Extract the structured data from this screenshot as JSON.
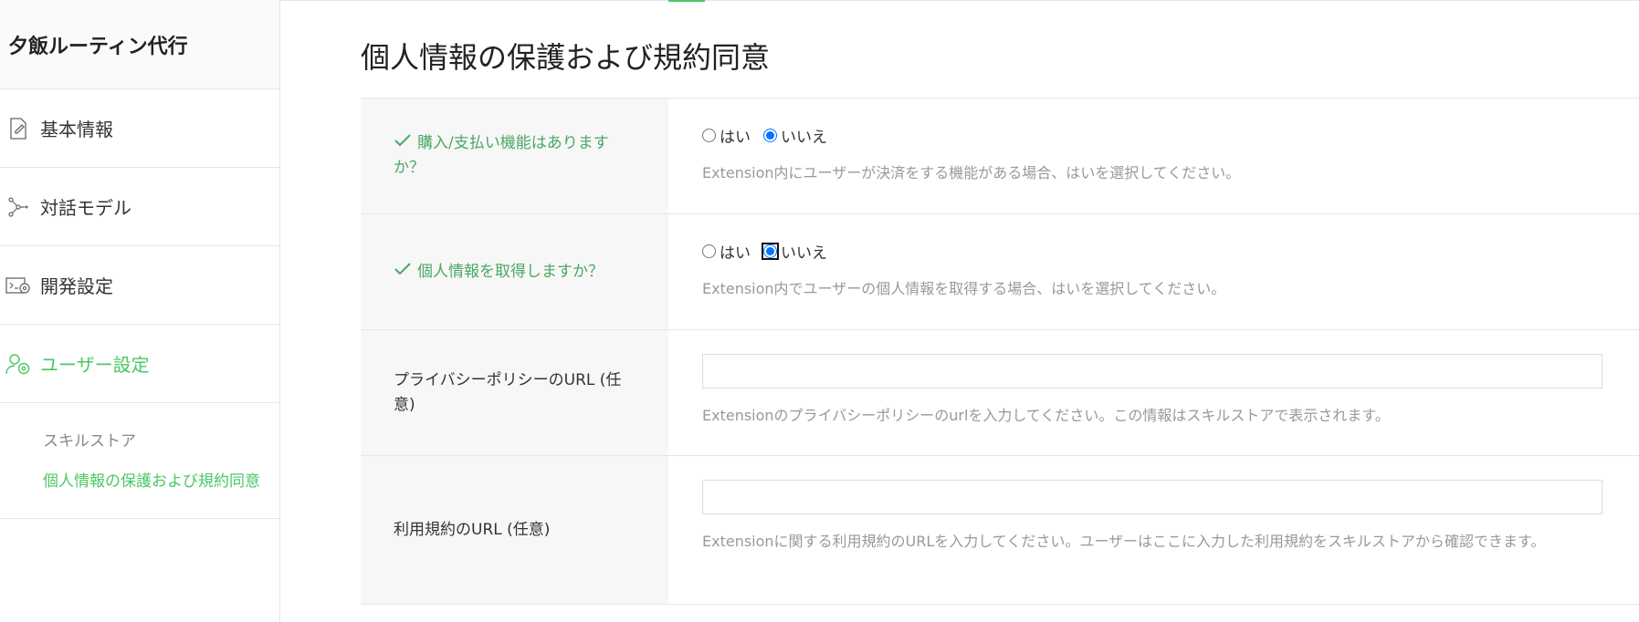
{
  "sidebar": {
    "title": "夕飯ルーティン代行",
    "items": [
      {
        "label": "基本情報",
        "icon": "edit-document-icon"
      },
      {
        "label": "対話モデル",
        "icon": "dialog-model-icon"
      },
      {
        "label": "開発設定",
        "icon": "dev-settings-icon"
      },
      {
        "label": "ユーザー設定",
        "icon": "user-settings-icon",
        "active": true
      }
    ],
    "subitems": [
      {
        "label": "スキルストア"
      },
      {
        "label": "個人情報の保護および規約同意",
        "active": true
      }
    ]
  },
  "main": {
    "title": "個人情報の保護および規約同意",
    "rows": {
      "purchase": {
        "label": "購入/支払い機能はありますか？",
        "yes": "はい",
        "no": "いいえ",
        "selected": "いいえ",
        "help": "Extension内にユーザーが決済をする機能がある場合、はいを選択してください。"
      },
      "personal": {
        "label": "個人情報を取得しますか？",
        "yes": "はい",
        "no": "いいえ",
        "selected": "いいえ",
        "help": "Extension内でユーザーの個人情報を取得する場合、はいを選択してください。"
      },
      "privacy": {
        "label": "プライバシーポリシーのURL (任意)",
        "value": "",
        "help": "Extensionのプライバシーポリシーのurlを入力してください。この情報はスキルストアで表示されます。"
      },
      "terms": {
        "label": "利用規約のURL (任意)",
        "value": "",
        "help": "Extensionに関する利用規約のURLを入力してください。ユーザーはここに入力した利用規約をスキルストアから確認できます。"
      }
    }
  },
  "colors": {
    "accent": "#4cc764",
    "check": "#4aa865"
  }
}
